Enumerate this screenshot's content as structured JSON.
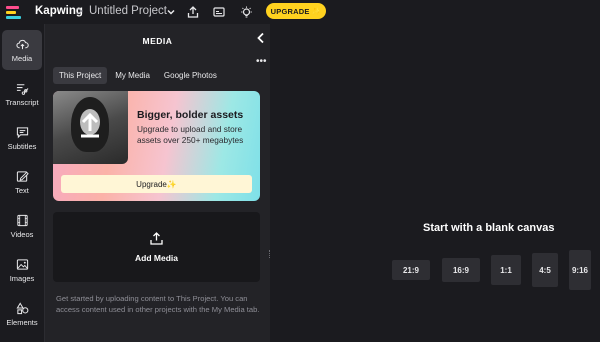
{
  "app": {
    "brand": "Kapwing",
    "breadcrumb_separator": ">",
    "project_title": "Untitled Project",
    "upgrade_label": "UPGRADE ✨",
    "accent_color": "#ffd21f"
  },
  "toolbar": {
    "icons": [
      "chevron-down-icon",
      "share-icon",
      "captions-icon",
      "lightbulb-icon"
    ]
  },
  "sidebar": {
    "items": [
      {
        "label": "Media",
        "icon": "cloud-upload-icon",
        "active": true
      },
      {
        "label": "Transcript",
        "icon": "transcript-icon",
        "active": false
      },
      {
        "label": "Subtitles",
        "icon": "subtitles-icon",
        "active": false
      },
      {
        "label": "Text",
        "icon": "text-edit-icon",
        "active": false
      },
      {
        "label": "Videos",
        "icon": "film-icon",
        "active": false
      },
      {
        "label": "Images",
        "icon": "image-icon",
        "active": false
      },
      {
        "label": "Elements",
        "icon": "shapes-icon",
        "active": false
      }
    ]
  },
  "media_panel": {
    "title": "MEDIA",
    "more_label": "•••",
    "tabs": [
      {
        "label": "This Project",
        "active": true
      },
      {
        "label": "My Media",
        "active": false
      },
      {
        "label": "Google Photos",
        "active": false
      }
    ],
    "promo": {
      "title": "Bigger, bolder assets",
      "text": "Upgrade to upload and store assets over 250+ megabytes",
      "button_label": "Upgrade✨"
    },
    "add_media_label": "Add Media",
    "help_text": "Get started by uploading content to This Project. You can access content used in other projects with the My Media tab."
  },
  "canvas": {
    "title": "Start with a blank canvas",
    "ratios": [
      "21:9",
      "16:9",
      "1:1",
      "4:5",
      "9:16"
    ]
  }
}
